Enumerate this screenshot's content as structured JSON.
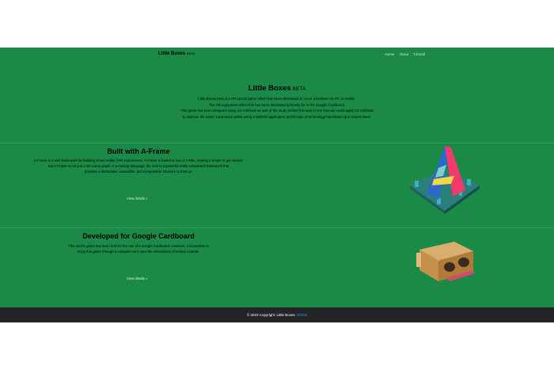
{
  "nav": {
    "brand": "Little Boxes",
    "brand_tag": "BETA",
    "links": [
      "Home",
      "About",
      "Tutorial"
    ]
  },
  "hero": {
    "title": "Little Boxes",
    "title_tag": "BETA",
    "lines": [
      "Little Boxes beta is a VR puzzle game which has been developed to run in a browser via PC or mobile.",
      "The VR equipment which this has been developed primarily for is the Google Cardboard.",
      "This game has been designed using UX methods as part of the study behind this was to see how we could apply UX methods",
      "to improve the users' experience whilst using a WebVR application as this type of technology has blown up in recent times."
    ]
  },
  "aframe": {
    "title": "Built with A-Frame",
    "lines": [
      "A-Frame is a web framework for building virtual reality (VR) experiences. A-Frame is based on top of HTML, making it simple to get started.",
      "But A-Frame is not just a 3D scene graph or a markup language; the core is a powerful entity-component framework that",
      "provides a declarative, extensible, and composable structure to three.js."
    ],
    "link": "View details »"
  },
  "cardboard": {
    "title": "Developed for Google Cardboard",
    "lines": [
      "This puzzle game has been built for the use of a Google Cardboard. However, it is possible to",
      "enjoy this game through a computer as it uses the interactions of mouse controls."
    ],
    "link": "View details »"
  },
  "footer": {
    "text": "© 2019 Copyright: Little Boxes",
    "github": "Github"
  },
  "colors": {
    "page_green": "#1a8a46",
    "footer_dark": "#222426",
    "link_blue": "#3b8ee8"
  }
}
